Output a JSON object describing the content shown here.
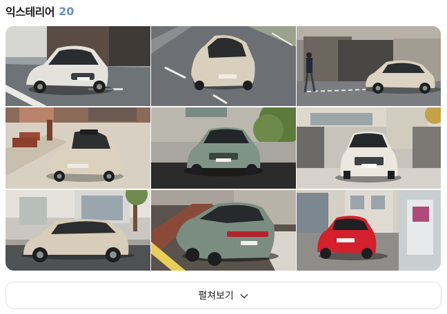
{
  "section": {
    "title": "익스테리어",
    "count": "20"
  },
  "gallery": {
    "images": [
      {
        "subject": "white-car-front-three-quarter-driving",
        "car_color": "#e4e2dc"
      },
      {
        "subject": "beige-car-top-view-road",
        "car_color": "#d9cfbd"
      },
      {
        "subject": "beige-car-side-person-walking",
        "car_color": "#ddd3c2"
      },
      {
        "subject": "beige-car-plaza-sunroof",
        "car_color": "#dcd1be"
      },
      {
        "subject": "green-car-front-studio",
        "car_color": "#7f9386"
      },
      {
        "subject": "white-car-front-building",
        "car_color": "#ece8df"
      },
      {
        "subject": "beige-car-side-profile",
        "car_color": "#d8ccba"
      },
      {
        "subject": "green-car-rear-three-quarter",
        "car_color": "#7b8c80"
      },
      {
        "subject": "red-car-rear-three-quarter",
        "car_color": "#d3202c"
      }
    ]
  },
  "expand_button": {
    "label": "펼쳐보기",
    "icon": "chevron-down-icon"
  }
}
